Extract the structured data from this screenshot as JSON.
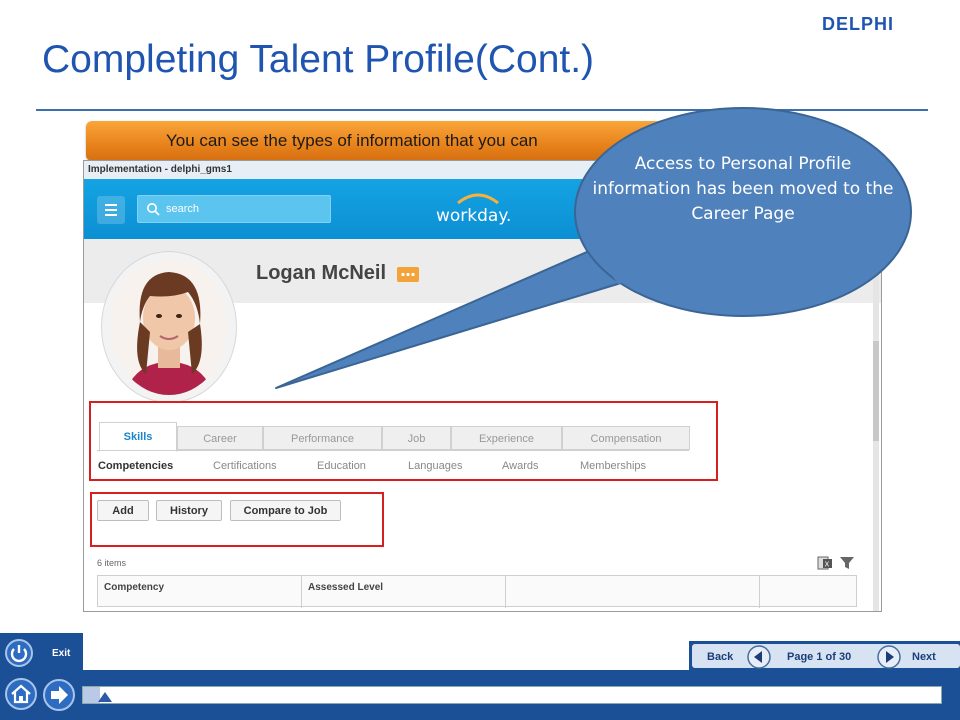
{
  "header": {
    "title": "Completing Talent Profile(Cont.)",
    "logo_text": "DELPHI",
    "banner_text": "You can see the types of information that you can"
  },
  "screenshot": {
    "window_title": "Implementation - delphi_gms1",
    "search_placeholder": "search",
    "brand": "workday.",
    "person_name": "Logan McNeil",
    "tabs": [
      {
        "label": "Skills",
        "active": true
      },
      {
        "label": "Career"
      },
      {
        "label": "Performance"
      },
      {
        "label": "Job"
      },
      {
        "label": "Experience"
      },
      {
        "label": "Compensation"
      }
    ],
    "subtabs": [
      {
        "label": "Competencies",
        "active": true
      },
      {
        "label": "Certifications"
      },
      {
        "label": "Education"
      },
      {
        "label": "Languages"
      },
      {
        "label": "Awards"
      },
      {
        "label": "Memberships"
      }
    ],
    "buttons": {
      "add": "Add",
      "history": "History",
      "compare": "Compare to Job"
    },
    "item_count": "6 items",
    "table_headers": [
      "Competency",
      "Assessed Level",
      "",
      ""
    ]
  },
  "callout": {
    "text": "Access to Personal Profile information has been moved to the Career Page"
  },
  "footer": {
    "exit_label": "Exit",
    "back_label": "Back",
    "next_label": "Next",
    "page_label": "Page 1 of 30",
    "progress_fraction": 0.0333
  },
  "colors": {
    "title": "#1f55b0",
    "banner": "#e8821b",
    "workday_bar": "#0c8fd3",
    "callout_fill": "#4f81bd",
    "highlight": "#d62020",
    "footer": "#1b4f96"
  }
}
